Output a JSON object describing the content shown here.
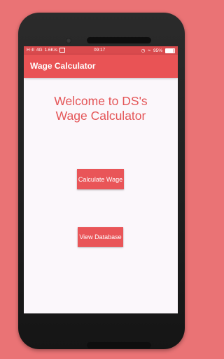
{
  "status_bar": {
    "signal_text": "H↑ll",
    "network": "4G",
    "speed": "1.6K/s",
    "time": "09:17",
    "battery": "95%"
  },
  "app_bar": {
    "title": "Wage Calculator"
  },
  "main": {
    "welcome_line1": "Welcome to DS's",
    "welcome_line2": "Wage Calculator",
    "calculate_button": "Calculate Wage",
    "database_button": "View Database"
  },
  "colors": {
    "background": "#ea7375",
    "app_bar": "#e95355",
    "accent_text": "#e45557",
    "button": "#e95558"
  }
}
